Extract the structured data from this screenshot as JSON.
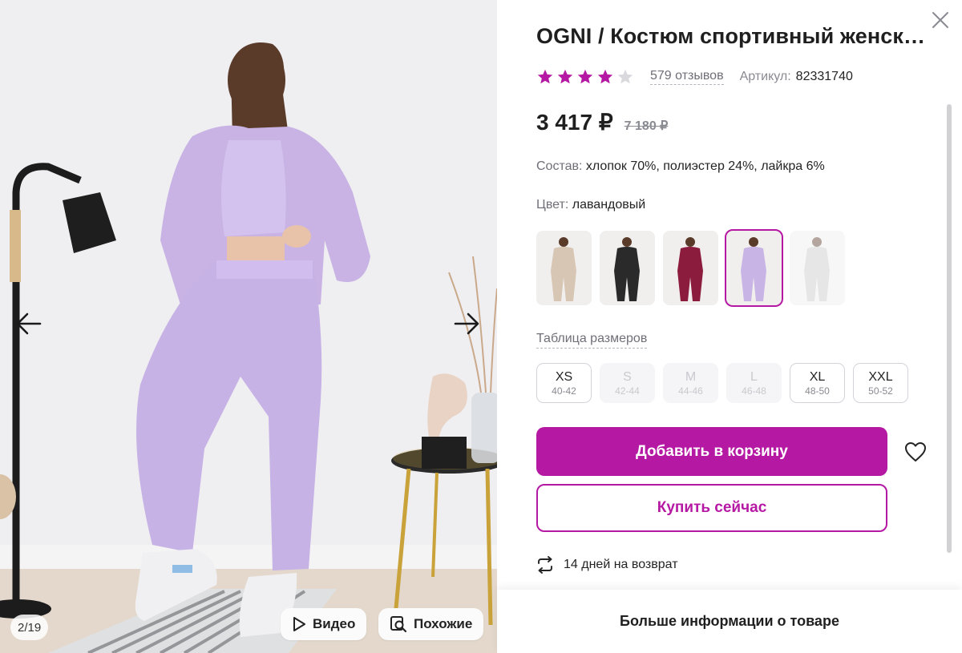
{
  "gallery": {
    "counter": "2/19",
    "video_label": "Видео",
    "similar_label": "Похожие",
    "icons": {
      "prev": "arrow-left-icon",
      "next": "arrow-right-icon",
      "video": "play-icon",
      "similar": "search-similar-icon"
    }
  },
  "product": {
    "title": "OGNI / Костюм спортивный женский",
    "rating": 4,
    "rating_max": 5,
    "reviews_label": "579 отзывов",
    "article_label": "Артикул:",
    "article_value": "82331740",
    "price": "3 417 ₽",
    "old_price": "7 180 ₽",
    "composition_label": "Состав:",
    "composition_value": "хлопок 70%, полиэстер 24%, лайкра 6%",
    "color_label": "Цвет:",
    "color_value": "лавандовый",
    "swatches": [
      {
        "name": "beige",
        "color": "#d8c6b4",
        "selected": false
      },
      {
        "name": "black",
        "color": "#2a2a2a",
        "selected": false
      },
      {
        "name": "burgundy",
        "color": "#8c1c3e",
        "selected": false
      },
      {
        "name": "lavender",
        "color": "#c9b4e6",
        "selected": true
      },
      {
        "name": "grey",
        "color": "#c8c8c8",
        "selected": false
      }
    ],
    "size_table_label": "Таблица размеров",
    "sizes": [
      {
        "name": "XS",
        "rus": "40-42",
        "available": true
      },
      {
        "name": "S",
        "rus": "42-44",
        "available": false
      },
      {
        "name": "M",
        "rus": "44-46",
        "available": false
      },
      {
        "name": "L",
        "rus": "46-48",
        "available": false
      },
      {
        "name": "XL",
        "rus": "48-50",
        "available": true
      },
      {
        "name": "XXL",
        "rus": "50-52",
        "available": true
      }
    ],
    "add_to_cart_label": "Добавить в корзину",
    "buy_now_label": "Купить сейчас",
    "return_label": "14 дней на возврат",
    "more_info_label": "Больше информации о товаре"
  },
  "colors": {
    "accent": "#b519a3",
    "star_filled": "#b519a3",
    "star_empty": "#d9d9de"
  }
}
